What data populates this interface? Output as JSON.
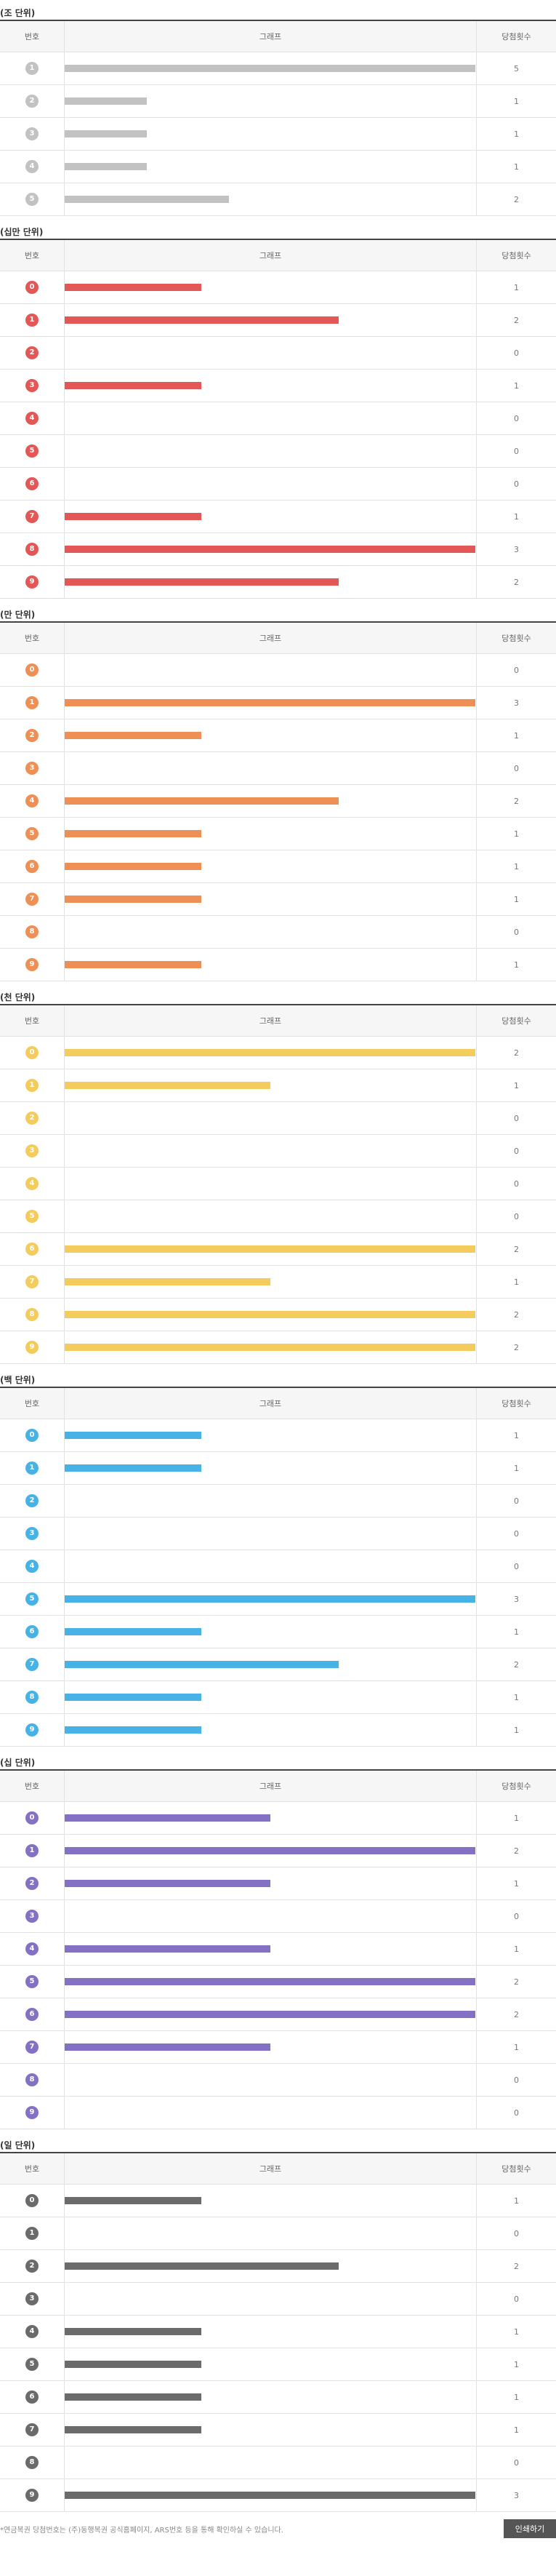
{
  "headers": {
    "number": "번호",
    "graph": "그래프",
    "count": "당첨횟수"
  },
  "colors": {
    "jo": "#c2c2c2",
    "sipeok": "#e35757",
    "eok": "#ee8f55",
    "cheonman": "#f4cc5e",
    "baekman": "#47b2e6",
    "sipman": "#8471c4",
    "man": "#6b6b6b"
  },
  "footer": {
    "note": "*연금복권 당첨번호는 (주)동행복권 공식홈페이지, ARS번호 등을 통해 확인하실 수 있습니다.",
    "button_label": "인쇄하기"
  },
  "chart_data": [
    {
      "type": "bar",
      "title": "(조 단위)",
      "color_key": "jo",
      "categories": [
        "1",
        "2",
        "3",
        "4",
        "5"
      ],
      "values": [
        5,
        1,
        1,
        1,
        2
      ],
      "xlim": [
        0,
        5
      ]
    },
    {
      "type": "bar",
      "title": "(십만 단위)",
      "color_key": "sipeok",
      "categories": [
        "0",
        "1",
        "2",
        "3",
        "4",
        "5",
        "6",
        "7",
        "8",
        "9"
      ],
      "values": [
        1,
        2,
        0,
        1,
        0,
        0,
        0,
        1,
        3,
        2
      ],
      "xlim": [
        0,
        3
      ]
    },
    {
      "type": "bar",
      "title": "(만 단위)",
      "color_key": "eok",
      "categories": [
        "0",
        "1",
        "2",
        "3",
        "4",
        "5",
        "6",
        "7",
        "8",
        "9"
      ],
      "values": [
        0,
        3,
        1,
        0,
        2,
        1,
        1,
        1,
        0,
        1
      ],
      "xlim": [
        0,
        3
      ]
    },
    {
      "type": "bar",
      "title": "(천 단위)",
      "color_key": "cheonman",
      "categories": [
        "0",
        "1",
        "2",
        "3",
        "4",
        "5",
        "6",
        "7",
        "8",
        "9"
      ],
      "values": [
        2,
        1,
        0,
        0,
        0,
        0,
        2,
        1,
        2,
        2
      ],
      "xlim": [
        0,
        2
      ]
    },
    {
      "type": "bar",
      "title": "(백 단위)",
      "color_key": "baekman",
      "categories": [
        "0",
        "1",
        "2",
        "3",
        "4",
        "5",
        "6",
        "7",
        "8",
        "9"
      ],
      "values": [
        1,
        1,
        0,
        0,
        0,
        3,
        1,
        2,
        1,
        1
      ],
      "xlim": [
        0,
        3
      ]
    },
    {
      "type": "bar",
      "title": "(십 단위)",
      "color_key": "sipman",
      "categories": [
        "0",
        "1",
        "2",
        "3",
        "4",
        "5",
        "6",
        "7",
        "8",
        "9"
      ],
      "values": [
        1,
        2,
        1,
        0,
        1,
        2,
        2,
        1,
        0,
        0
      ],
      "xlim": [
        0,
        2
      ]
    },
    {
      "type": "bar",
      "title": "(일 단위)",
      "color_key": "man",
      "categories": [
        "0",
        "1",
        "2",
        "3",
        "4",
        "5",
        "6",
        "7",
        "8",
        "9"
      ],
      "values": [
        1,
        0,
        2,
        0,
        1,
        1,
        1,
        1,
        0,
        3
      ],
      "xlim": [
        0,
        3
      ]
    }
  ]
}
